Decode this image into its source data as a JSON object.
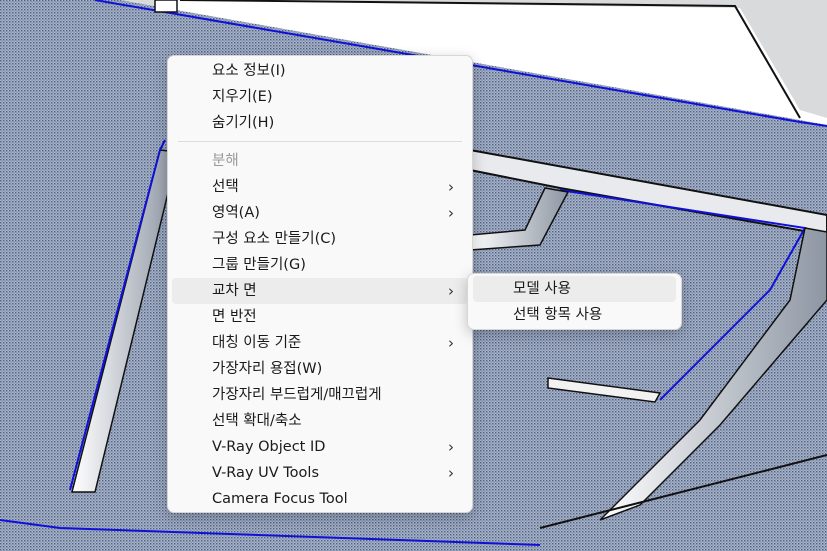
{
  "context_menu": {
    "items": [
      {
        "label": "요소 정보(I)",
        "disabled": false,
        "submenu": false
      },
      {
        "label": "지우기(E)",
        "disabled": false,
        "submenu": false
      },
      {
        "label": "숨기기(H)",
        "disabled": false,
        "submenu": false
      },
      {
        "separator": true
      },
      {
        "label": "분해",
        "disabled": true,
        "submenu": false
      },
      {
        "label": "선택",
        "disabled": false,
        "submenu": true
      },
      {
        "label": "영역(A)",
        "disabled": false,
        "submenu": true
      },
      {
        "label": "구성 요소 만들기(C)",
        "disabled": false,
        "submenu": false
      },
      {
        "label": "그룹 만들기(G)",
        "disabled": false,
        "submenu": false
      },
      {
        "label": "교차 면",
        "disabled": false,
        "submenu": true,
        "highlighted": true
      },
      {
        "label": "면 반전",
        "disabled": false,
        "submenu": false
      },
      {
        "label": "대칭 이동 기준",
        "disabled": false,
        "submenu": true
      },
      {
        "label": "가장자리 용접(W)",
        "disabled": false,
        "submenu": false
      },
      {
        "label": "가장자리 부드럽게/매끄럽게",
        "disabled": false,
        "submenu": false
      },
      {
        "label": "선택 확대/축소",
        "disabled": false,
        "submenu": false
      },
      {
        "label": "V-Ray Object ID",
        "disabled": false,
        "submenu": true
      },
      {
        "label": "V-Ray UV Tools",
        "disabled": false,
        "submenu": true
      },
      {
        "label": "Camera Focus Tool",
        "disabled": false,
        "submenu": false
      }
    ],
    "submenu_arrow": "›"
  },
  "submenu": {
    "items": [
      {
        "label": "모델 사용",
        "highlighted": true
      },
      {
        "label": "선택 항목 사용",
        "highlighted": false
      }
    ]
  },
  "colors": {
    "selection_edge": "#1010d8",
    "face_dots": "#8f9db8",
    "background": "#d9dadc",
    "white_face": "#ffffff"
  }
}
